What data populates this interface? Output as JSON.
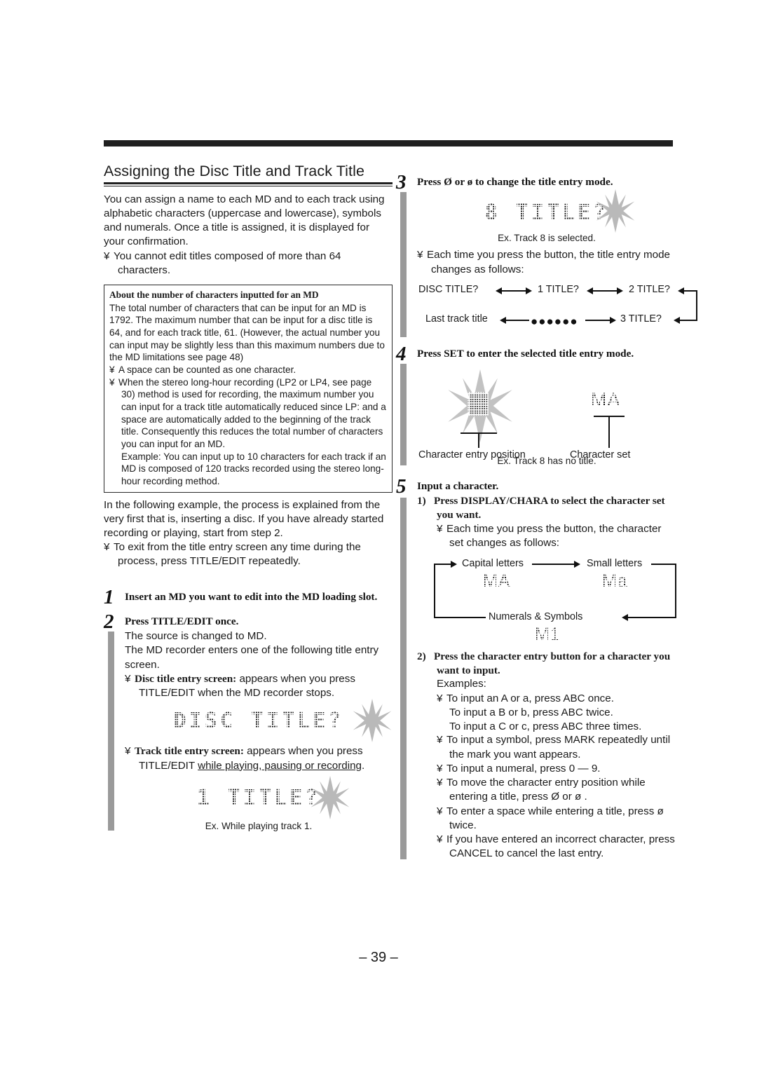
{
  "page": {
    "number": "– 39 –"
  },
  "left": {
    "title": "Assigning the Disc Title and Track Title",
    "intro": "You can assign a name to each MD and to each track using alphabetic characters (uppercase and lowercase), symbols and numerals. Once a title is assigned, it is displayed for your confirmation.",
    "intro_bullet": "You cannot edit titles composed of more than 64 characters.",
    "bullet_mark": "¥",
    "notebox": {
      "heading": "About the number of characters inputted for an MD",
      "para": "The total number of characters that can be input for an MD is 1792. The maximum number that can be input for a disc title is 64, and for each track title, 61. (However, the actual number you can input may be slightly less than this maximum numbers due to the MD limitations  see page 48)",
      "bullet1": "A space can be counted as one character.",
      "bullet2": "When the stereo long-hour recording (LP2 or LP4, see page 30) method is used for recording, the maximum number you can input for a track title automatically reduced since  LP: and a space are automatically added to the beginning of the track title. Consequently this reduces the total number of characters you can input for an MD.",
      "example": "Example: You can input up to 10 characters for each track if an MD is composed of 120 tracks recorded using the stereo long-hour recording method."
    },
    "after_note": "In the following example, the process is explained from the very first  that is, inserting a disc. If you have already started recording or playing, start from step 2.",
    "after_note_bullet": "To exit from the title entry screen any time during the process, press TITLE/EDIT repeatedly.",
    "steps": [
      {
        "num": "1",
        "head": "Insert an MD you want to edit into the MD loading slot."
      },
      {
        "num": "2",
        "head": "Press TITLE/EDIT once.",
        "body1": "The source is changed to  MD.",
        "body2": "The MD recorder enters one of the following title entry screen.",
        "bullet1_bold": "Disc title entry screen:",
        "bullet1_rest": " appears when you press TITLE/EDIT when the MD recorder stops.",
        "lcd1": "DISC TITLE?",
        "bullet2_bold": "Track title entry screen:",
        "bullet2_rest_a": " appears when you press TITLE/EDIT ",
        "bullet2_rest_u": "while playing, pausing or recording",
        "bullet2_rest_b": ".",
        "lcd2": "1 TITLE?",
        "caption2": "Ex. While playing track 1."
      }
    ]
  },
  "right": {
    "step3": {
      "num": "3",
      "head_a": "Press ",
      "head_sym1": "Ø",
      "head_b": "  or ",
      "head_sym2": "ø",
      "head_c": "  to change the title entry mode.",
      "lcd": "8 TITLE?",
      "caption": "Ex. Track 8 is selected.",
      "bullet": "Each time you press the button, the title entry mode changes as follows:",
      "flow": {
        "n1": "DISC TITLE?",
        "n2": "1 TITLE?",
        "n3": "2 TITLE?",
        "n4": "3 TITLE?",
        "dots": "●●●●●●",
        "n5": "Last track title"
      }
    },
    "step4": {
      "num": "4",
      "head": "Press SET to enter the selected title entry mode.",
      "lcd_charset": "MA",
      "label_pos": "Character entry position",
      "label_set": "Character set",
      "caption": "Ex. Track 8 has no title."
    },
    "step5": {
      "num": "5",
      "head": "Input a character.",
      "sub1": {
        "n": "1)",
        "head": "Press DISPLAY/CHARA to select the character set you want.",
        "bullet": "Each time you press the button, the character set changes as follows:"
      },
      "cycle": {
        "capital": "Capital letters",
        "capital_lcd": "MA",
        "small": "Small letters",
        "small_lcd": "Ma",
        "numerals": "Numerals & Symbols",
        "numerals_lcd": "M1"
      },
      "sub2": {
        "n": "2)",
        "head": "Press the character entry button for a character you want to input.",
        "examples_label": "Examples:",
        "ex1a": "To input an  A  or  a,  press ABC once.",
        "ex1b": "To input a  B  or  b,  press ABC twice.",
        "ex1c": "To input a  C  or  c,  press ABC three times.",
        "ex2": "To input a symbol, press MARK repeatedly until the mark you want appears.",
        "ex3": "To input a numeral, press 0 — 9.",
        "ex4a": "To move the character entry position while entering a title, press ",
        "ex4sym1": "Ø",
        "ex4b": "  or ",
        "ex4sym2": "ø",
        "ex4c": "  .",
        "ex5a": "To enter a space while entering a title, press ",
        "ex5sym": "ø",
        "ex5b": " twice.",
        "ex6": "If you have entered an incorrect character, press CANCEL to cancel the last entry."
      }
    }
  },
  "colors": {
    "rule": "#1f1f1f",
    "step_rule": "#9a9a9a",
    "text": "#1a1a1a"
  }
}
